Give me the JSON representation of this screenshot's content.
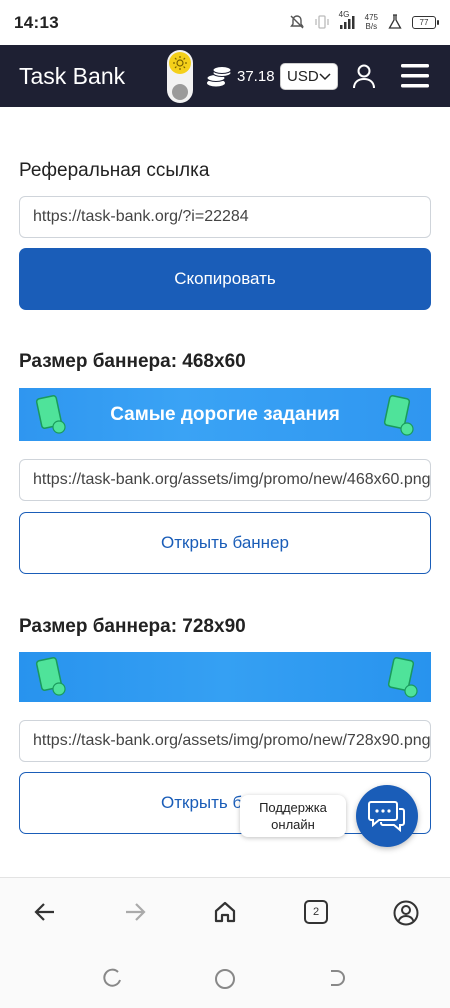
{
  "status": {
    "time": "14:13",
    "network": "4G",
    "speed_value": "475",
    "speed_unit": "B/s",
    "battery": "77"
  },
  "header": {
    "brand": "Task Bank",
    "balance": "37.18",
    "currency": "USD"
  },
  "referral": {
    "title": "Реферальная ссылка",
    "link": "https://task-bank.org/?i=22284",
    "copy_button": "Скопировать"
  },
  "banners": [
    {
      "title": "Размер баннера: 468x60",
      "banner_text": "Самые дорогие задания",
      "url": "https://task-bank.org/assets/img/promo/new/468x60.png",
      "open_button": "Открыть баннер"
    },
    {
      "title": "Размер баннера: 728x90",
      "banner_text": "",
      "url": "https://task-bank.org/assets/img/promo/new/728x90.png",
      "open_button": "Открыть баннер"
    }
  ],
  "support": {
    "label_line1": "Поддержка",
    "label_line2": "онлайн"
  },
  "browser": {
    "tabs_count": "2"
  },
  "colors": {
    "header_bg": "#1e2033",
    "primary": "#1a5db8",
    "banner_blue": "#2f96f0",
    "accent_green": "#3ddc84"
  },
  "icons": [
    "dnd-off-icon",
    "vibrate-icon",
    "signal-icon",
    "wifi-icon",
    "flask-icon",
    "sun-icon",
    "coins-icon",
    "chevron-down-icon",
    "user-icon",
    "menu-icon",
    "chat-icon",
    "back-arrow-icon",
    "forward-arrow-icon",
    "home-icon",
    "tabs-icon",
    "profile-icon"
  ]
}
